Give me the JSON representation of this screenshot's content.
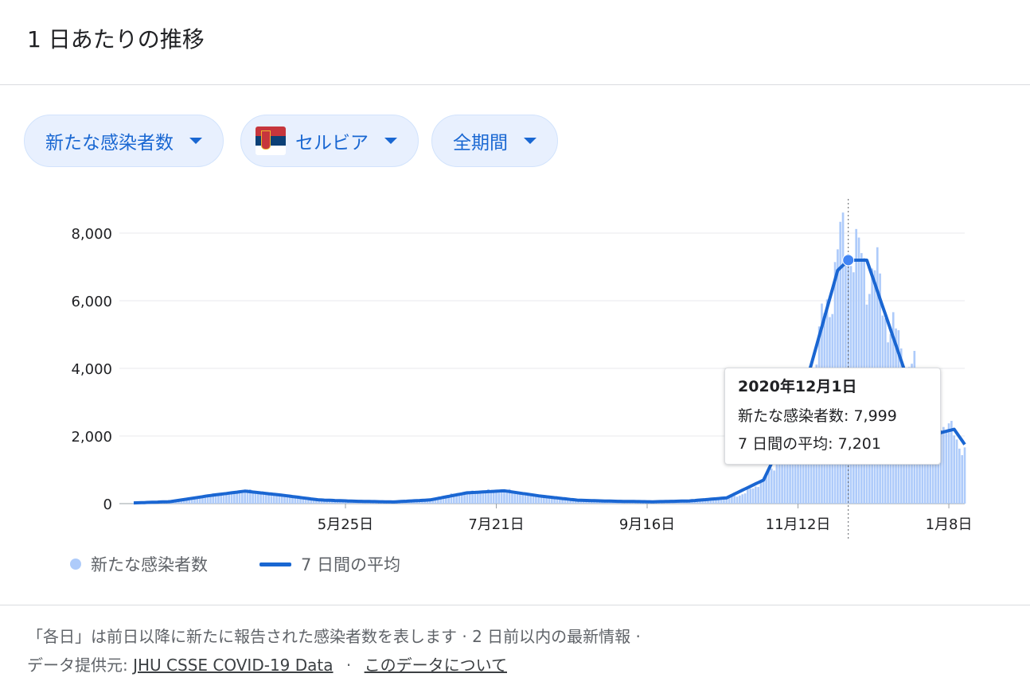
{
  "title": "1 日あたりの推移",
  "filters": [
    {
      "label": "新たな感染者数"
    },
    {
      "label": "セルビア",
      "icon": "serbia-flag-icon"
    },
    {
      "label": "全期間"
    }
  ],
  "colors": {
    "accent": "#1967d2",
    "bar": "#aecbfa",
    "chip_bg": "#e8f0fe",
    "line": "#1a66d2"
  },
  "tooltip": {
    "date": "2020年12月1日",
    "cases_label": "新たな感染者数: ",
    "cases_value": "7,999",
    "avg_label": "7 日間の平均: ",
    "avg_value": "7,201"
  },
  "legend": {
    "cases": "新たな感染者数",
    "average": "7 日間の平均"
  },
  "footer": {
    "note": "「各日」は前日以降に新たに報告された感染者数を表します · 2 日前以内の最新情報 ·",
    "source_label": "データ提供元:",
    "source_link": "JHU CSSE COVID-19 Data",
    "sep": "·",
    "about_link": "このデータについて"
  },
  "chart_data": {
    "type": "bar",
    "title": "",
    "xlabel": "",
    "ylabel": "",
    "ylim": [
      0,
      8500
    ],
    "yticks": [
      0,
      2000,
      4000,
      6000,
      8000
    ],
    "ytick_labels": [
      "0",
      "2,000",
      "4,000",
      "6,000",
      "8,000"
    ],
    "xtick_labels": [
      "5月25日",
      "7月21日",
      "9月16日",
      "11月12日",
      "1月8日"
    ],
    "grid": true,
    "legend_position": "bottom-left",
    "highlight": {
      "label": "2020年12月1日",
      "cases": 7999,
      "average": 7201
    },
    "series": [
      {
        "name": "新たな感染者数",
        "kind": "bar",
        "points": [
          [
            "2020-03-06",
            20
          ],
          [
            "2020-03-13",
            30
          ],
          [
            "2020-03-20",
            70
          ],
          [
            "2020-03-27",
            150
          ],
          [
            "2020-04-03",
            250
          ],
          [
            "2020-04-10",
            290
          ],
          [
            "2020-04-17",
            390
          ],
          [
            "2020-04-24",
            310
          ],
          [
            "2020-05-01",
            260
          ],
          [
            "2020-05-08",
            200
          ],
          [
            "2020-05-15",
            110
          ],
          [
            "2020-05-22",
            80
          ],
          [
            "2020-05-29",
            70
          ],
          [
            "2020-06-05",
            40
          ],
          [
            "2020-06-12",
            50
          ],
          [
            "2020-06-19",
            80
          ],
          [
            "2020-06-26",
            110
          ],
          [
            "2020-07-03",
            250
          ],
          [
            "2020-07-10",
            330
          ],
          [
            "2020-07-17",
            360
          ],
          [
            "2020-07-24",
            400
          ],
          [
            "2020-07-31",
            300
          ],
          [
            "2020-08-07",
            230
          ],
          [
            "2020-08-14",
            150
          ],
          [
            "2020-08-21",
            100
          ],
          [
            "2020-08-28",
            80
          ],
          [
            "2020-09-04",
            70
          ],
          [
            "2020-09-11",
            60
          ],
          [
            "2020-09-18",
            50
          ],
          [
            "2020-09-25",
            60
          ],
          [
            "2020-10-02",
            80
          ],
          [
            "2020-10-09",
            120
          ],
          [
            "2020-10-16",
            170
          ],
          [
            "2020-10-23",
            300
          ],
          [
            "2020-10-30",
            700
          ],
          [
            "2020-11-06",
            1500
          ],
          [
            "2020-11-13",
            2800
          ],
          [
            "2020-11-20",
            4800
          ],
          [
            "2020-11-27",
            7300
          ],
          [
            "2020-12-01",
            7999
          ],
          [
            "2020-12-04",
            7200
          ],
          [
            "2020-12-11",
            6800
          ],
          [
            "2020-12-18",
            5000
          ],
          [
            "2020-12-25",
            4000
          ],
          [
            "2021-01-01",
            2800
          ],
          [
            "2021-01-08",
            2200
          ],
          [
            "2021-01-14",
            1600
          ]
        ]
      },
      {
        "name": "7 日間の平均",
        "kind": "line",
        "points": [
          [
            "2020-03-06",
            20
          ],
          [
            "2020-03-20",
            60
          ],
          [
            "2020-04-03",
            230
          ],
          [
            "2020-04-17",
            370
          ],
          [
            "2020-05-01",
            250
          ],
          [
            "2020-05-15",
            110
          ],
          [
            "2020-05-29",
            70
          ],
          [
            "2020-06-12",
            50
          ],
          [
            "2020-06-26",
            110
          ],
          [
            "2020-07-10",
            320
          ],
          [
            "2020-07-24",
            380
          ],
          [
            "2020-08-07",
            220
          ],
          [
            "2020-08-21",
            100
          ],
          [
            "2020-09-04",
            70
          ],
          [
            "2020-09-18",
            55
          ],
          [
            "2020-10-02",
            80
          ],
          [
            "2020-10-16",
            170
          ],
          [
            "2020-10-30",
            700
          ],
          [
            "2020-11-13",
            3000
          ],
          [
            "2020-11-27",
            6900
          ],
          [
            "2020-12-01",
            7201
          ],
          [
            "2020-12-08",
            7200
          ],
          [
            "2020-12-15",
            5600
          ],
          [
            "2020-12-22",
            4000
          ],
          [
            "2020-12-29",
            2800
          ],
          [
            "2021-01-05",
            2100
          ],
          [
            "2021-01-10",
            2200
          ],
          [
            "2021-01-14",
            1750
          ]
        ]
      }
    ]
  }
}
